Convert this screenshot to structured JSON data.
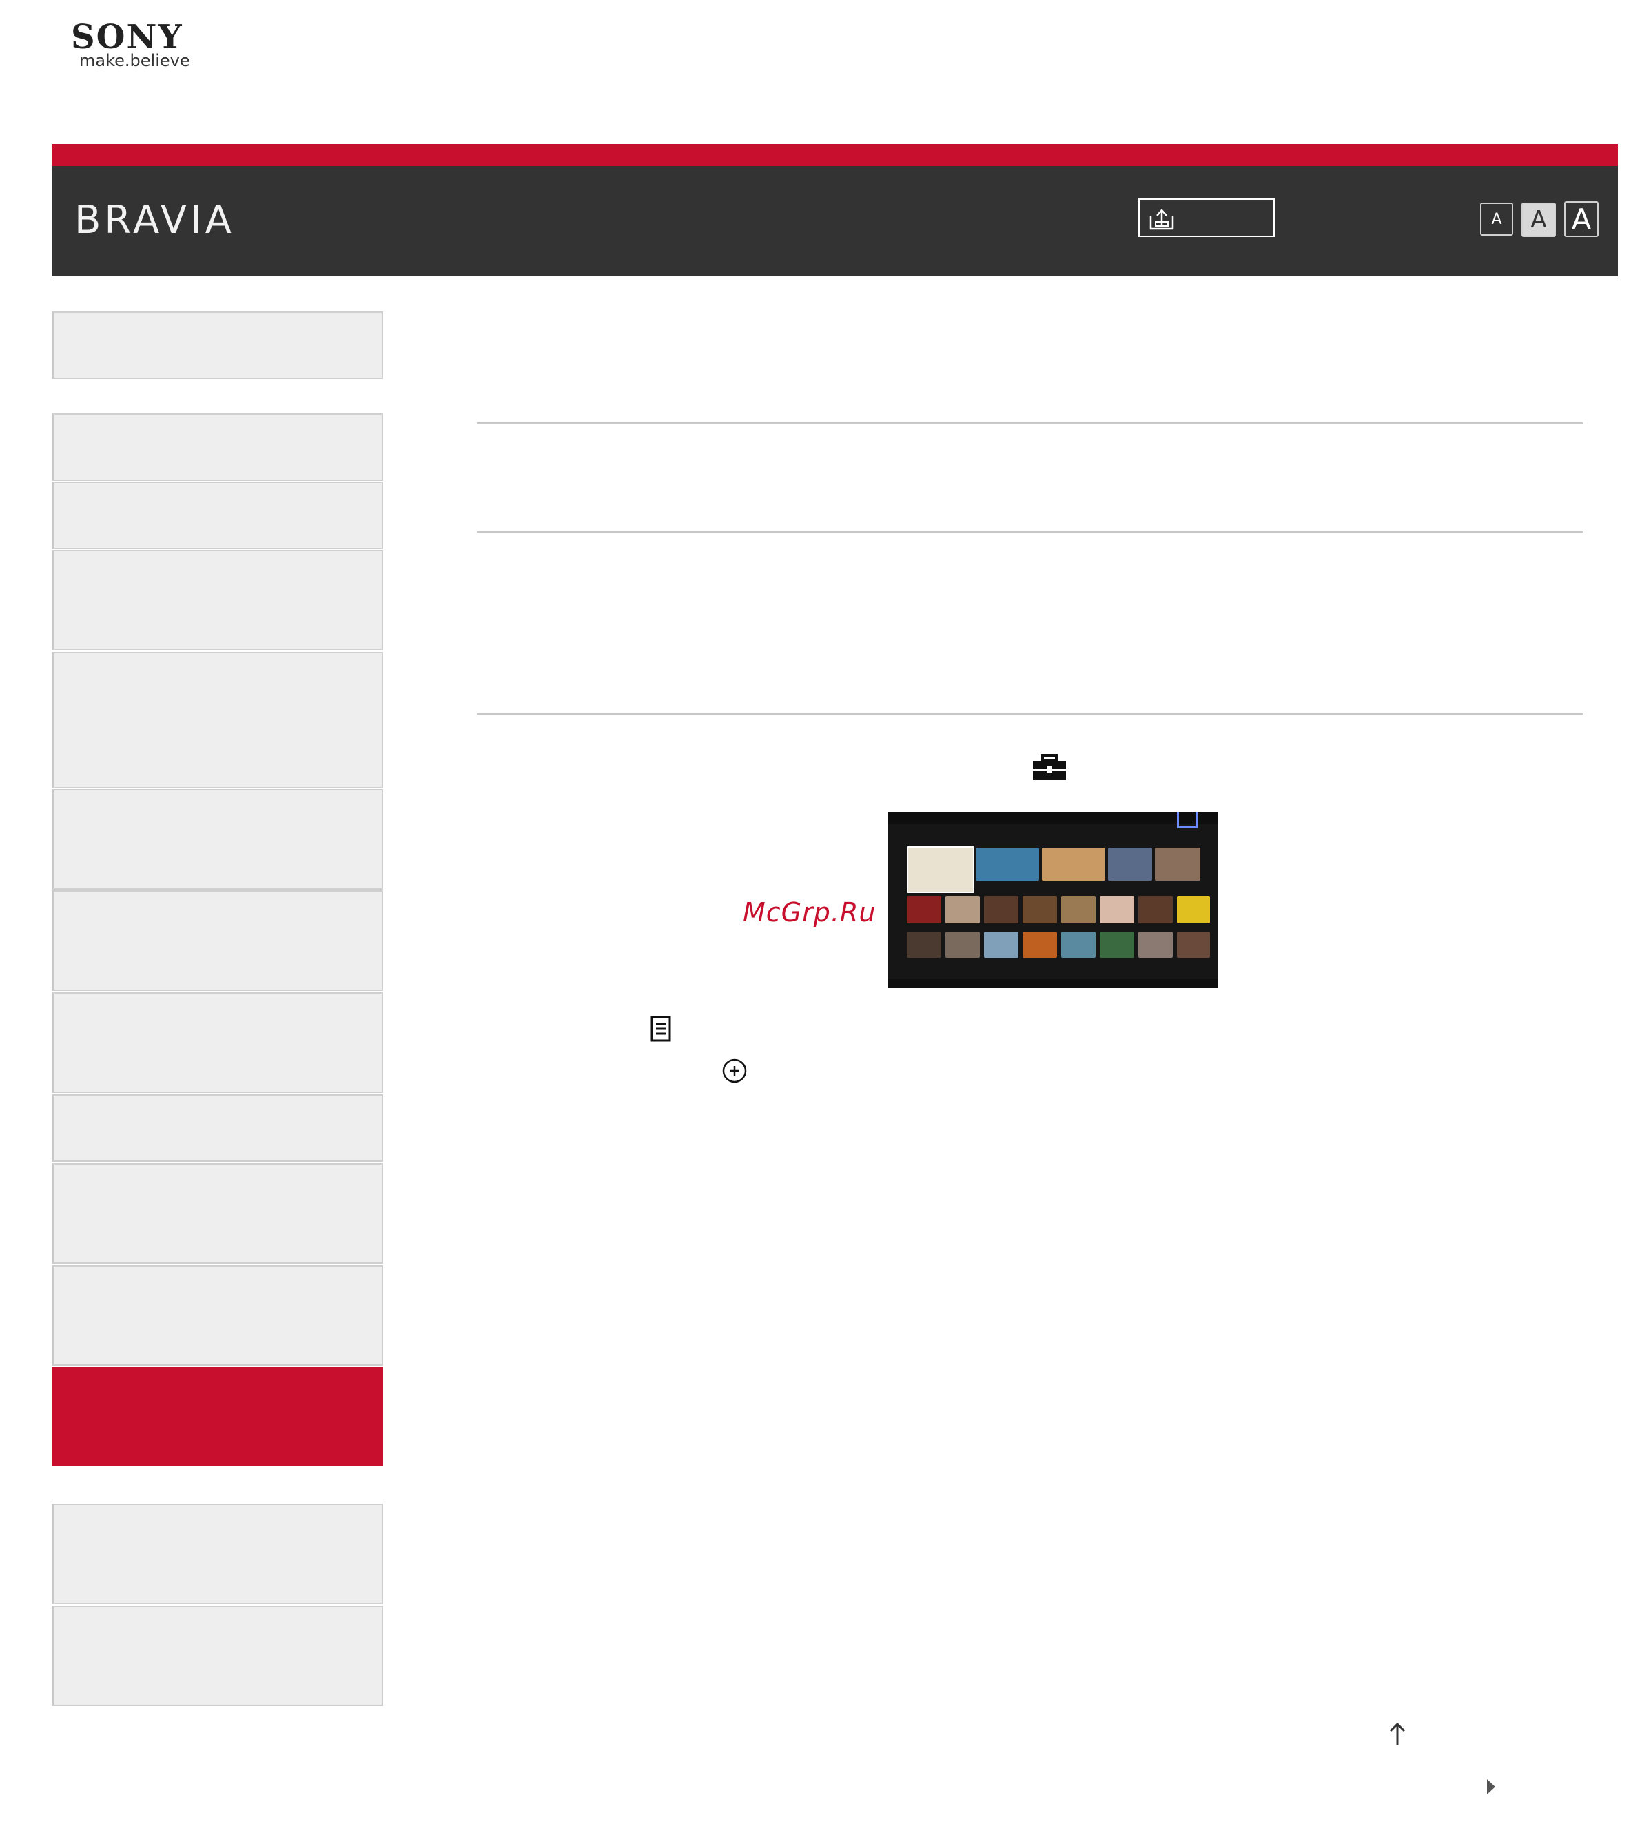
{
  "logo": {
    "brand": "SONY",
    "tagline": "make.believe"
  },
  "header": {
    "title": "BRAVIA",
    "print_icon": "print-icon",
    "font_sizes": [
      "A",
      "A",
      "A"
    ]
  },
  "sidebar": {
    "items_count": 14,
    "active_index": 11
  },
  "content": {
    "tools_icon": "toolbox-icon",
    "options_icon": "options-icon",
    "enter_icon": "enter-icon"
  },
  "watermark": "McGrp.Ru",
  "colors": {
    "accent": "#c8102e",
    "header_bg": "#333333",
    "sidebar_bg": "#eeeeee"
  }
}
